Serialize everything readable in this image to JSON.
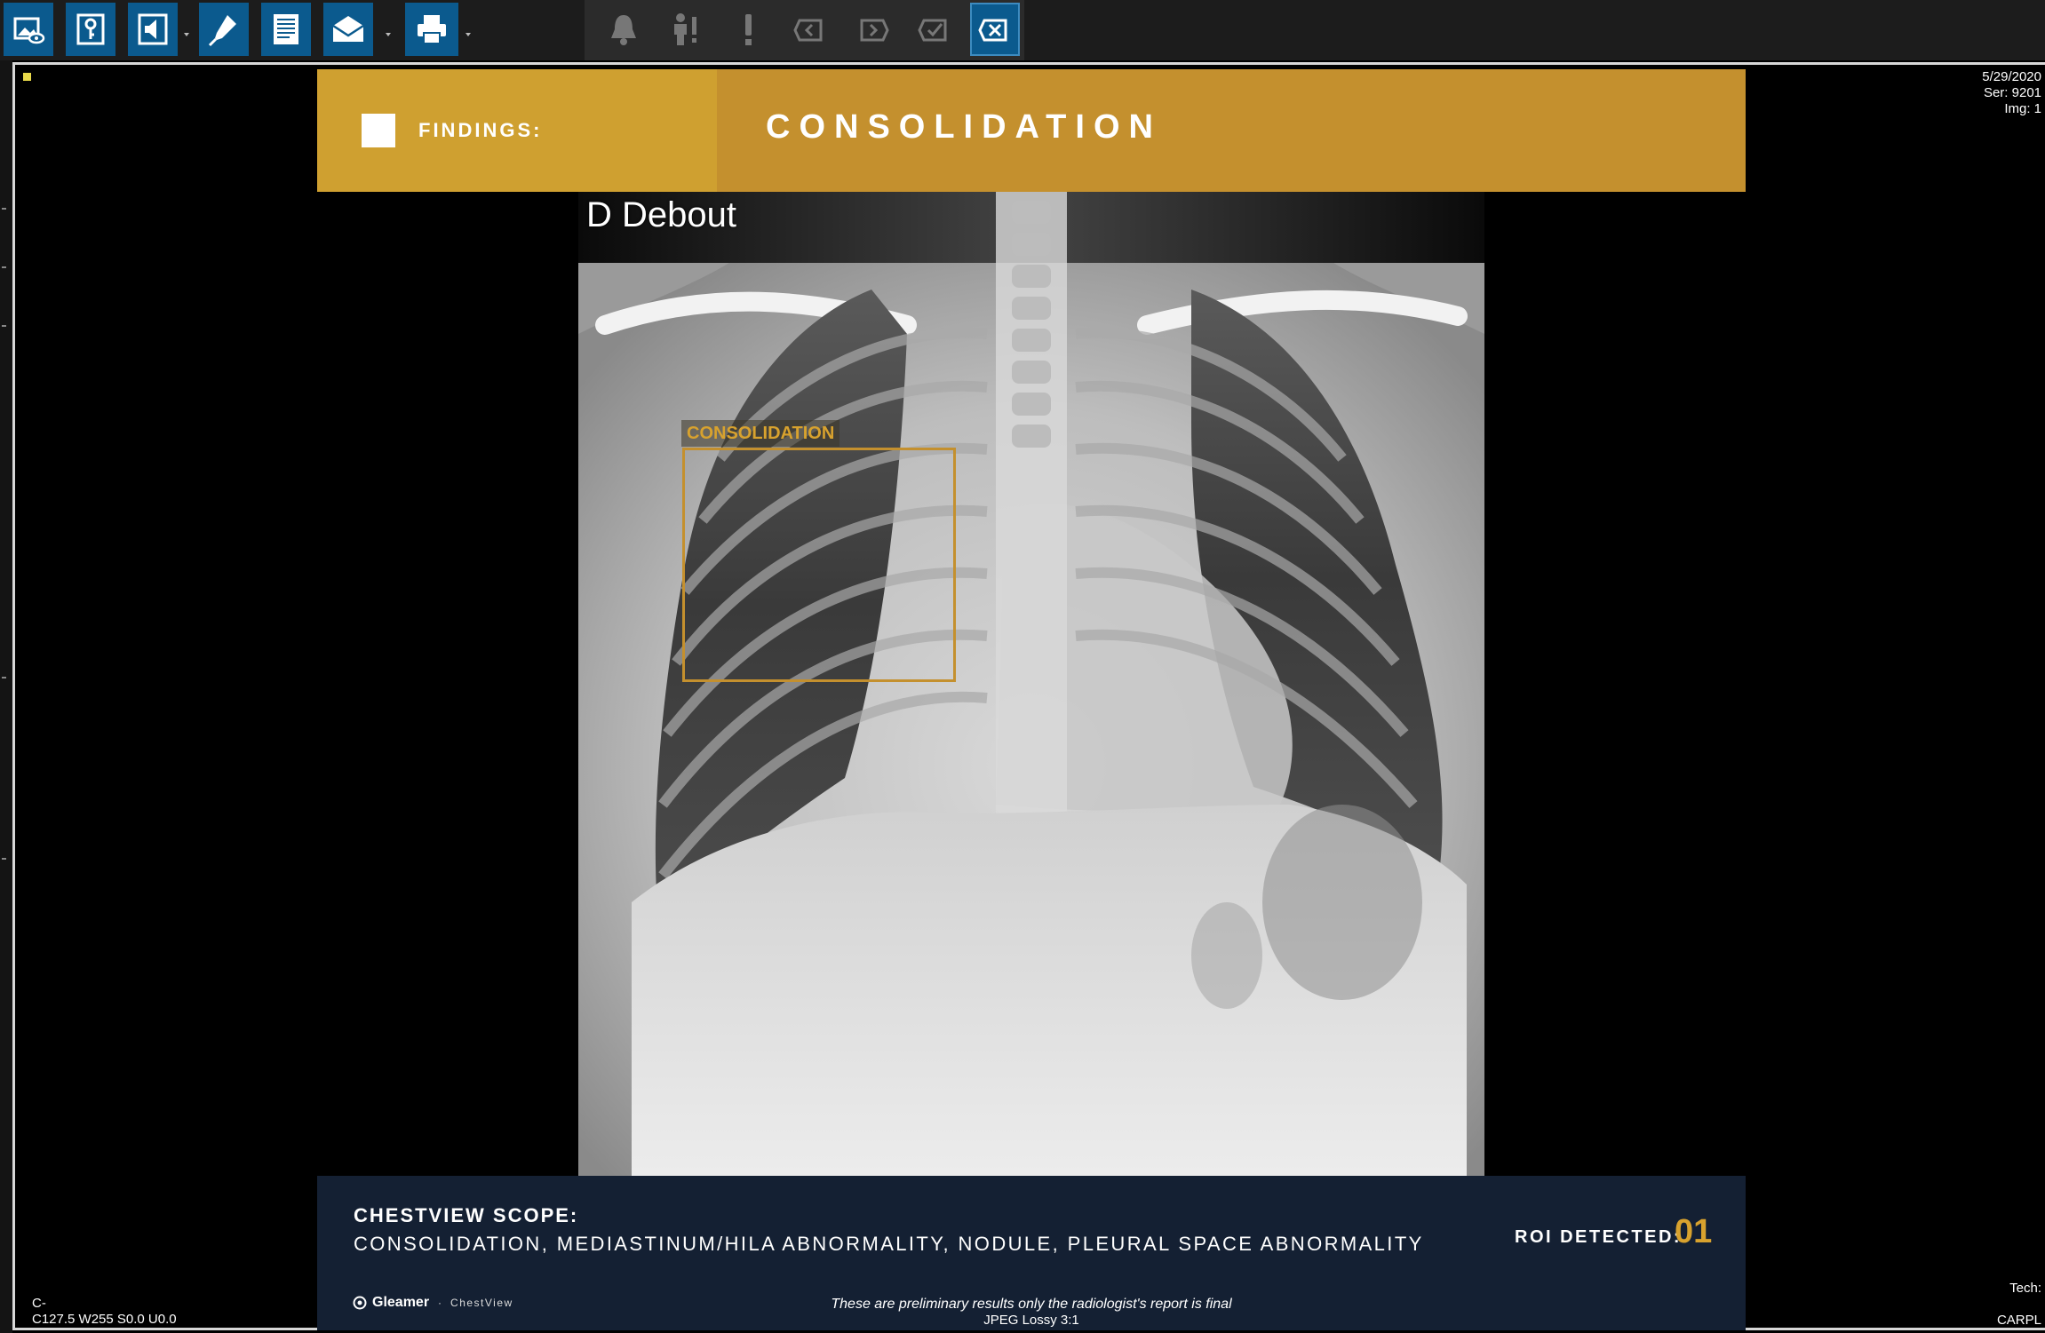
{
  "toolbar": {
    "buttons": [
      {
        "icon": "image-view-icon"
      },
      {
        "icon": "key-icon"
      },
      {
        "icon": "speaker-icon"
      },
      {
        "icon": "microphone-icon"
      },
      {
        "icon": "report-document-icon"
      },
      {
        "icon": "envelope-icon"
      },
      {
        "icon": "printer-icon"
      },
      {
        "icon": "bell-icon"
      },
      {
        "icon": "person-alert-icon"
      },
      {
        "icon": "exclamation-icon"
      },
      {
        "icon": "tag-back-icon"
      },
      {
        "icon": "tag-forward-icon"
      },
      {
        "icon": "tag-check-icon"
      },
      {
        "icon": "tag-close-icon"
      }
    ]
  },
  "findings": {
    "label": "FINDINGS:",
    "value": "CONSOLIDATION",
    "color": "#c4902e"
  },
  "image": {
    "patient_label": "D Debout",
    "roi_label": "CONSOLIDATION"
  },
  "scope": {
    "title": "CHESTVIEW SCOPE:",
    "items": "CONSOLIDATION, MEDIASTINUM/HILA ABNORMALITY, NODULE, PLEURAL SPACE ABNORMALITY",
    "roi_detected_label": "ROI DETECTED:",
    "roi_count": "01"
  },
  "footer": {
    "brand_name": "Gleamer",
    "separator": "·",
    "product": "ChestView",
    "disclaimer": "These are preliminary results only the radiologist's report is final",
    "compression": "JPEG Lossy 3:1"
  },
  "overlays": {
    "top_right": {
      "date": "5/29/2020",
      "series": "Ser: 9201",
      "image": "Img: 1"
    },
    "bottom_left": {
      "line1": "C-",
      "line2": "C127.5 W255 S0.0 U0.0"
    },
    "bottom_right": {
      "tech": "Tech:",
      "site": "CARPL"
    }
  },
  "colors": {
    "toolbar_button": "#0b5a8e",
    "accent_gold": "#d8a22e",
    "scope_panel": "#142033"
  }
}
